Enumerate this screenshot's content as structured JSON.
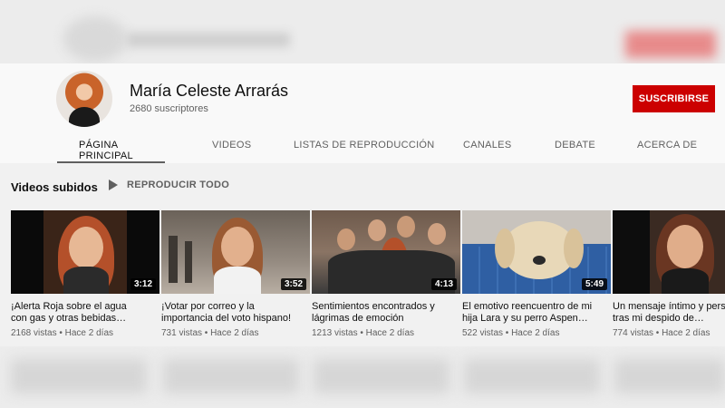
{
  "channel": {
    "name": "María Celeste Arrarás",
    "subscribers": "2680 suscriptores",
    "subscribe_label": "SUSCRIBIRSE"
  },
  "tabs": [
    {
      "label": "PÁGINA PRINCIPAL",
      "active": true
    },
    {
      "label": "VIDEOS"
    },
    {
      "label": "LISTAS DE REPRODUCCIÓN"
    },
    {
      "label": "CANALES"
    },
    {
      "label": "DEBATE"
    },
    {
      "label": "ACERCA DE"
    }
  ],
  "uploads": {
    "title": "Videos subidos",
    "play_all_label": "REPRODUCIR TODO",
    "play_icon": "play-icon",
    "videos": [
      {
        "title_line1": "¡Alerta Roja sobre el agua",
        "title_line2": "con gas y otras bebidas…",
        "duration": "3:12",
        "meta": "2168 vistas • Hace 2 días"
      },
      {
        "title_line1": "¡Votar por correo y la",
        "title_line2": "importancia del voto hispano!",
        "duration": "3:52",
        "meta": "731 vistas • Hace 2 días"
      },
      {
        "title_line1": "Sentimientos encontrados y",
        "title_line2": "lágrimas de emoción",
        "duration": "4:13",
        "meta": "1213 vistas • Hace 2 días"
      },
      {
        "title_line1": "El emotivo reencuentro de mi",
        "title_line2": "hija Lara y su perro Aspen…",
        "duration": "5:49",
        "meta": "522 vistas • Hace 2 días"
      },
      {
        "title_line1": "Un mensaje íntimo y personal",
        "title_line2": "tras mi despido de…",
        "duration": "",
        "meta": "774 vistas • Hace 2 días"
      }
    ]
  },
  "colors": {
    "subscribe_bg": "#cc0000",
    "text_primary": "#0f0f0f",
    "text_secondary": "#606060"
  }
}
